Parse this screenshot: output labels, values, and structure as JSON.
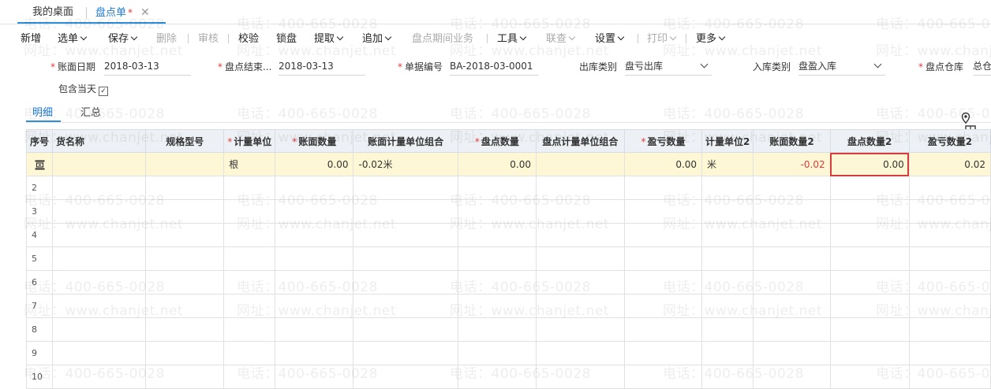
{
  "tabs": {
    "home": "我的桌面",
    "active": "盘点单",
    "active_modified": "*",
    "close": "✕"
  },
  "toolbar": [
    {
      "label": "新增",
      "enabled": true,
      "dropdown": false
    },
    {
      "label": "选单",
      "enabled": true,
      "dropdown": true
    },
    {
      "label": "保存",
      "enabled": true,
      "dropdown": true
    },
    {
      "label": "删除",
      "enabled": false,
      "dropdown": false
    },
    {
      "label": "审核",
      "enabled": false,
      "dropdown": false
    },
    {
      "label": "校验",
      "enabled": true,
      "dropdown": false
    },
    {
      "label": "锁盘",
      "enabled": true,
      "dropdown": false
    },
    {
      "label": "提取",
      "enabled": true,
      "dropdown": true
    },
    {
      "label": "追加",
      "enabled": true,
      "dropdown": true
    },
    {
      "label": "盘点期间业务",
      "enabled": false,
      "dropdown": false
    },
    {
      "label": "工具",
      "enabled": true,
      "dropdown": true
    },
    {
      "label": "联查",
      "enabled": false,
      "dropdown": true
    },
    {
      "label": "设置",
      "enabled": true,
      "dropdown": true
    },
    {
      "label": "打印",
      "enabled": false,
      "dropdown": true
    },
    {
      "label": "更多",
      "enabled": true,
      "dropdown": true
    }
  ],
  "form": {
    "book_date_label": "账面日期",
    "book_date": "2018-03-13",
    "end_date_label": "盘点结束...",
    "end_date": "2018-03-13",
    "doc_no_label": "单据编号",
    "doc_no": "BA-2018-03-0001",
    "out_type_label": "出库类别",
    "out_type": "盘亏出库",
    "in_type_label": "入库类别",
    "in_type": "盘盈入库",
    "warehouse_label": "盘点仓库",
    "warehouse": "总仓",
    "include_today_label": "包含当天",
    "include_today_checked": true
  },
  "subtabs": {
    "detail": "明细",
    "summary": "汇总"
  },
  "grid": {
    "columns": [
      {
        "label": "序号",
        "required": false
      },
      {
        "label": "货名称",
        "required": false
      },
      {
        "label": "规格型号",
        "required": false
      },
      {
        "label": "计量单位",
        "required": true
      },
      {
        "label": "账面数量",
        "required": true
      },
      {
        "label": "账面计量单位组合",
        "required": false
      },
      {
        "label": "盘点数量",
        "required": true
      },
      {
        "label": "盘点计量单位组合",
        "required": false
      },
      {
        "label": "盈亏数量",
        "required": true
      },
      {
        "label": "计量单位2",
        "required": false
      },
      {
        "label": "账面数量2",
        "required": false
      },
      {
        "label": "盘点数量2",
        "required": false
      },
      {
        "label": "盈亏数量2",
        "required": false
      }
    ],
    "first_row": {
      "name": "",
      "spec": "",
      "unit": "根",
      "book_qty": "0.00",
      "book_unit_combo": "-0.02米",
      "count_qty": "0.00",
      "count_unit_combo": "",
      "diff_qty": "0.00",
      "unit2": "米",
      "book_qty2": "-0.02",
      "count_qty2": "0.00",
      "diff_qty2": "0.02"
    },
    "row_numbers": [
      "2",
      "3",
      "4",
      "5",
      "6",
      "7",
      "8",
      "9",
      "10"
    ]
  },
  "watermark": {
    "phone": "电话：400-665-0028",
    "site": "网址：www.chanjet.net"
  },
  "colors": {
    "accent": "#1d7ad8",
    "required": "#e23a3a",
    "selected_row": "#fdf7d6",
    "header_bg": "#edf1f5"
  }
}
